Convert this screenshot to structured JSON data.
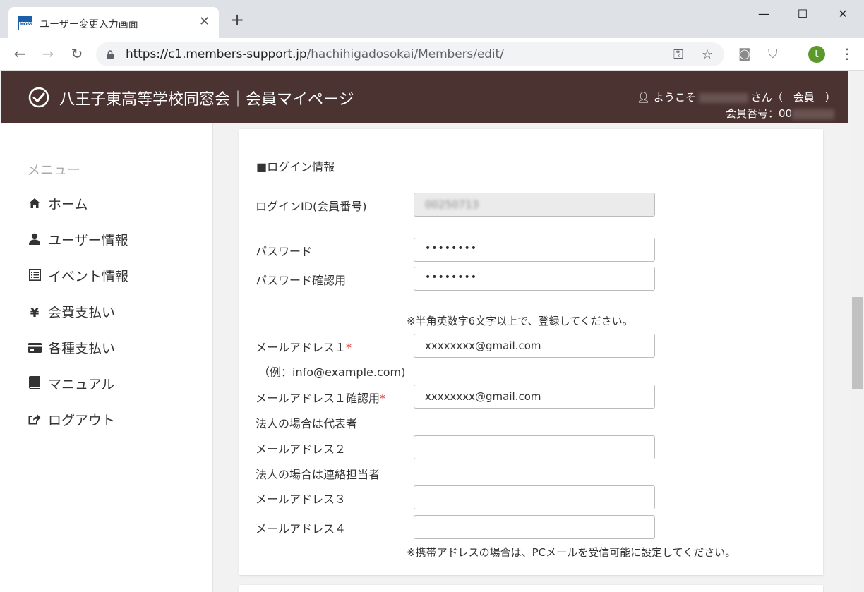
{
  "browser": {
    "tab_title": "ユーザー変更入力画面",
    "favicon_text": "MOSS",
    "url_host": "https://c1.members-support.jp",
    "url_path": "/hachihigadosokai/Members/edit/",
    "profile_initial": "t"
  },
  "header": {
    "site_title": "八王子東高等学校同窓会｜会員マイページ",
    "welcome_prefix": "ようこそ",
    "welcome_suffix": "さん（　会員　）",
    "member_no_label": "会員番号：00"
  },
  "sidebar": {
    "heading": "メニュー",
    "items": [
      {
        "label": "ホーム",
        "icon": "home-icon"
      },
      {
        "label": "ユーザー情報",
        "icon": "user-icon"
      },
      {
        "label": "イベント情報",
        "icon": "list-icon"
      },
      {
        "label": "会費支払い",
        "icon": "yen-icon"
      },
      {
        "label": "各種支払い",
        "icon": "card-icon"
      },
      {
        "label": "マニュアル",
        "icon": "book-icon"
      },
      {
        "label": "ログアウト",
        "icon": "logout-icon"
      }
    ]
  },
  "form": {
    "section_title": "■ログイン情報",
    "login_id_label": "ログインID(会員番号)",
    "login_id_value": "00250713",
    "password_label": "パスワード",
    "password_value": "••••••••",
    "password_confirm_label": "パスワード確認用",
    "password_confirm_value": "••••••••",
    "password_note": "※半角英数字6文字以上で、登録してください。",
    "email1_label": "メールアドレス１",
    "email1_example": "（例：info@example.com)",
    "email1_value": "xxxxxxxx@gmail.com",
    "email1_confirm_label": "メールアドレス１確認用",
    "email1_confirm_value": "xxxxxxxx@gmail.com",
    "corp_rep_note": "法人の場合は代表者",
    "email2_label": "メールアドレス２",
    "email2_value": "",
    "corp_contact_note": "法人の場合は連絡担当者",
    "email3_label": "メールアドレス３",
    "email3_value": "",
    "email4_label": "メールアドレス４",
    "email4_value": "",
    "mobile_note": "※携帯アドレスの場合は、PCメールを受信可能に設定してください。",
    "required_mark": "*"
  },
  "colors": {
    "header_bg": "#4a3331",
    "required": "#d9342b",
    "avatar": "#5b9a2a"
  }
}
